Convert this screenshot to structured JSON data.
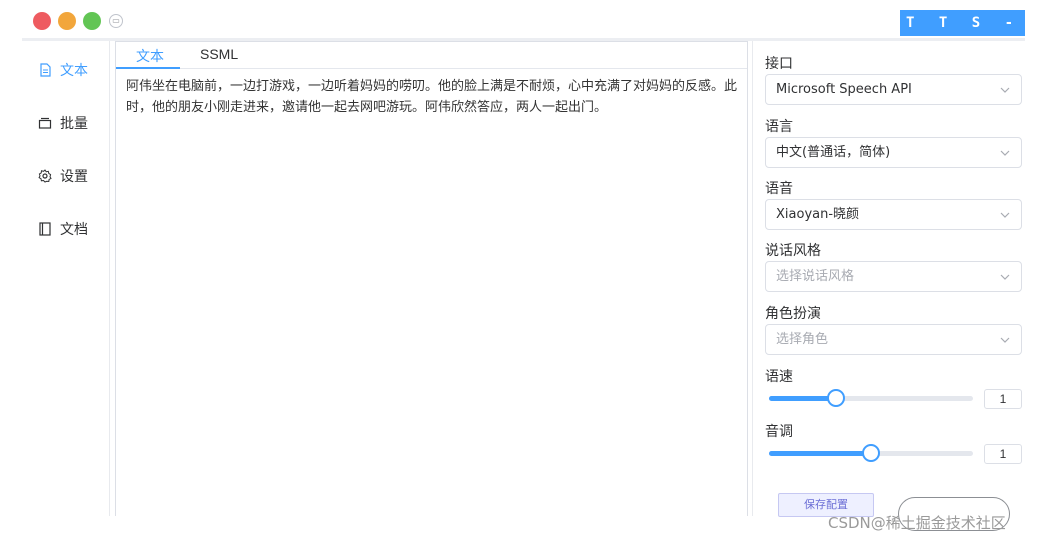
{
  "window": {
    "brand": "T T S - V U E"
  },
  "sidebar": {
    "items": [
      {
        "label": "文本",
        "icon": "document-icon",
        "active": true
      },
      {
        "label": "批量",
        "icon": "batch-icon",
        "active": false
      },
      {
        "label": "设置",
        "icon": "gear-icon",
        "active": false
      },
      {
        "label": "文档",
        "icon": "book-icon",
        "active": false
      }
    ]
  },
  "editor": {
    "tabs": [
      {
        "label": "文本",
        "active": true
      },
      {
        "label": "SSML",
        "active": false
      }
    ],
    "text": "阿伟坐在电脑前，一边打游戏，一边听着妈妈的唠叨。他的脸上满是不耐烦，心中充满了对妈妈的反感。此时，他的朋友小刚走进来，邀请他一起去网吧游玩。阿伟欣然答应，两人一起出门。"
  },
  "config": {
    "interface_label": "接口",
    "interface_value": "Microsoft Speech API",
    "language_label": "语言",
    "language_value": "中文(普通话，简体)",
    "voice_label": "语音",
    "voice_value": "Xiaoyan-晓颜",
    "style_label": "说话风格",
    "style_placeholder": "选择说话风格",
    "role_label": "角色扮演",
    "role_placeholder": "选择角色",
    "speed_label": "语速",
    "speed_value": "1",
    "speed_fraction": 0.33,
    "pitch_label": "音调",
    "pitch_value": "1",
    "pitch_fraction": 0.5,
    "save_label": "保存配置"
  },
  "watermark": "CSDN@稀土掘金技术社区",
  "colors": {
    "accent": "#409eff",
    "close": "#ee5b60",
    "minimize": "#f2a63b",
    "maximize": "#62c554"
  }
}
